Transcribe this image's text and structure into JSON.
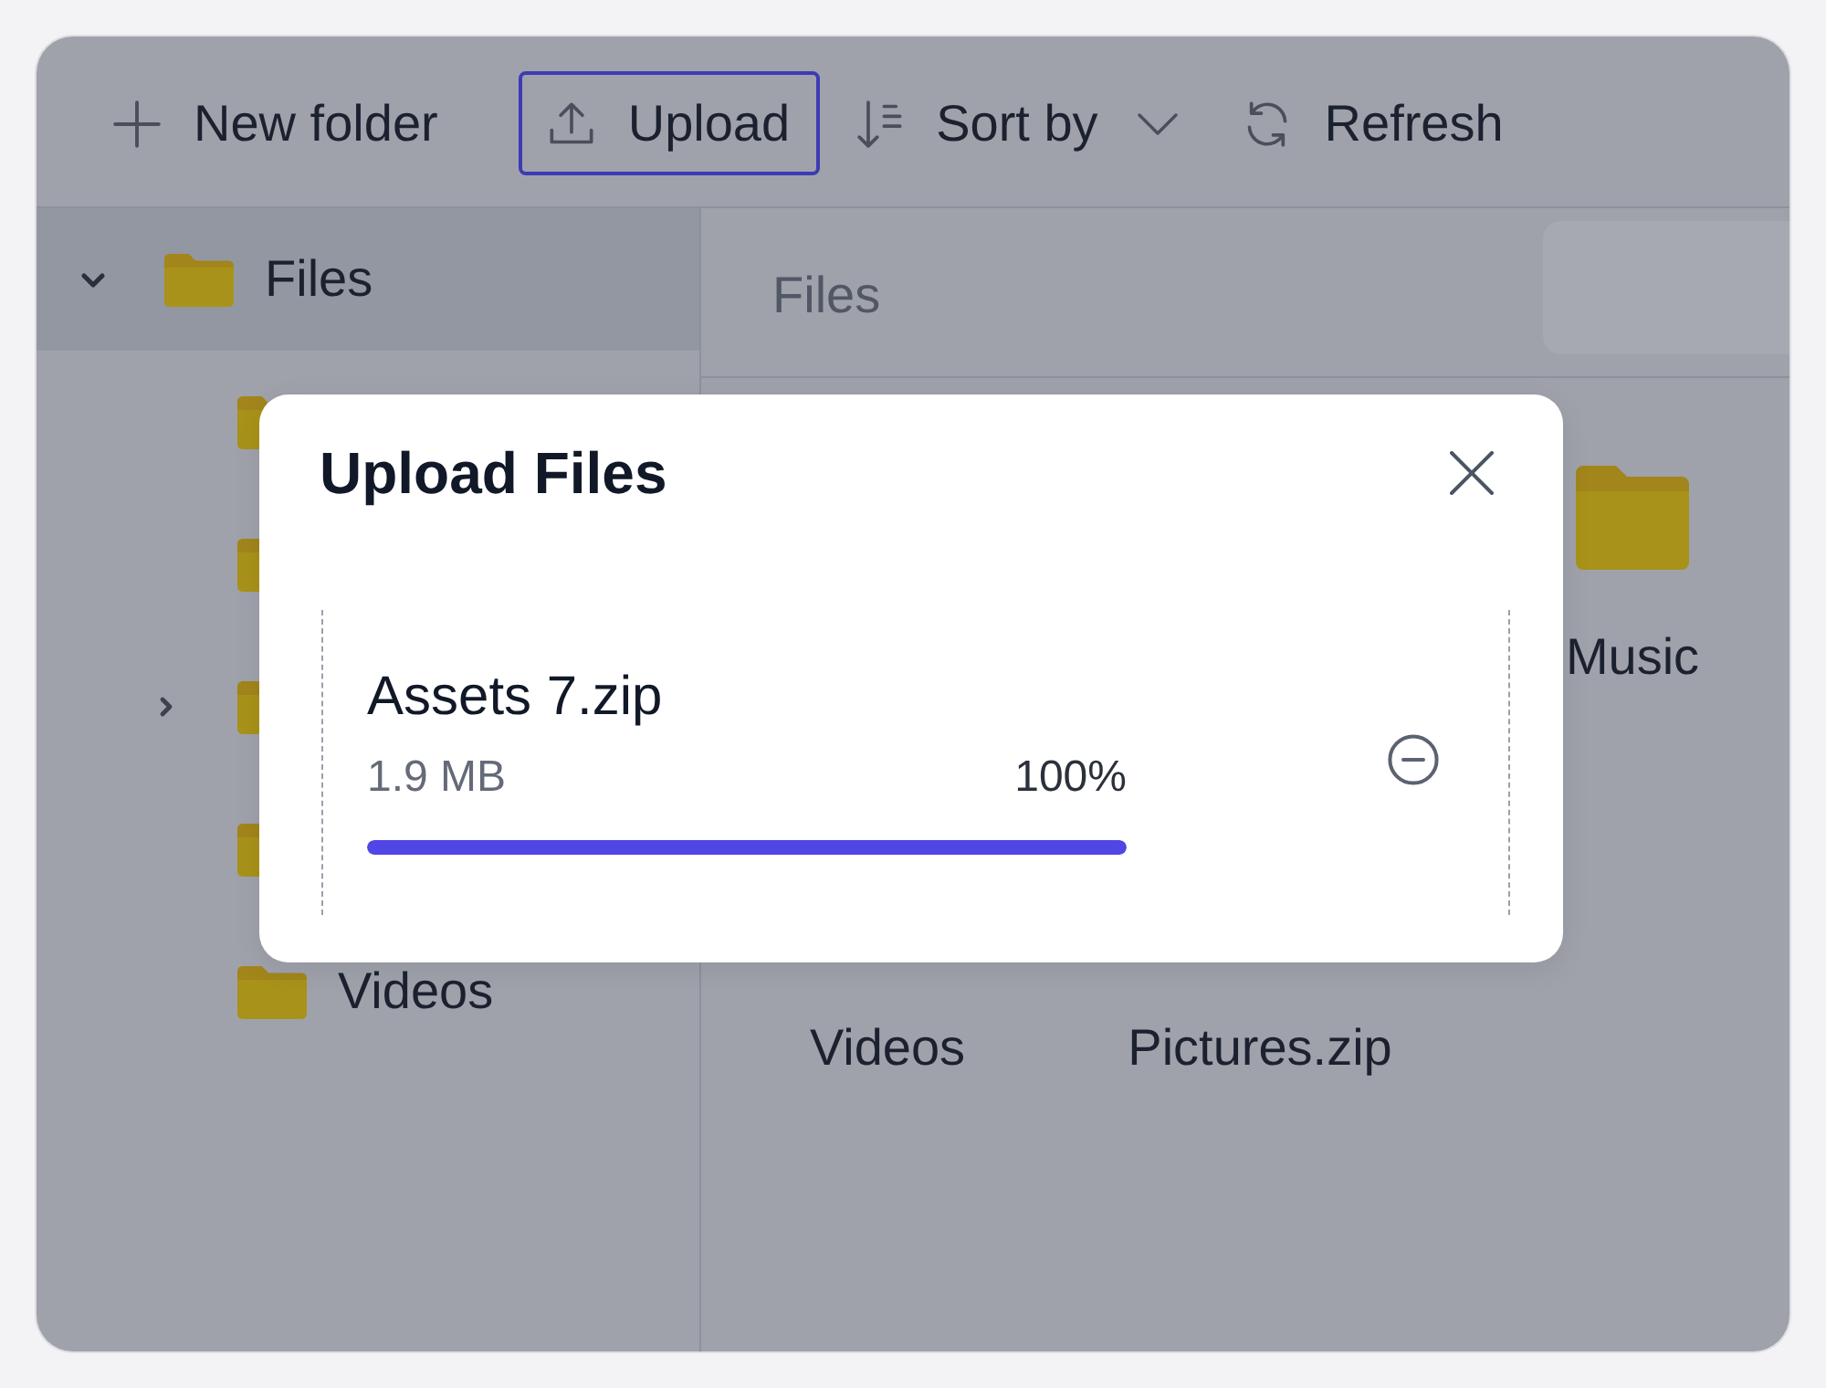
{
  "toolbar": {
    "buttons": [
      {
        "kind": "new_folder",
        "label": "New folder",
        "focused": false
      },
      {
        "kind": "upload",
        "label": "Upload",
        "focused": true
      },
      {
        "kind": "sort",
        "label": "Sort by",
        "focused": false
      },
      {
        "kind": "refresh",
        "label": "Refresh",
        "focused": false
      }
    ]
  },
  "sidebar": {
    "tree": [
      {
        "label": "Files",
        "selected": true,
        "expanded": true,
        "children": [
          {
            "selected": false
          },
          {
            "selected": false
          },
          {
            "selected": false,
            "expanded": false
          },
          {
            "selected": false
          },
          {
            "label": "Videos",
            "selected": false
          }
        ]
      }
    ]
  },
  "breadcrumb": {
    "path": [
      "Files"
    ]
  },
  "grid": {
    "items": [
      {
        "label": "Music",
        "kind": "folder"
      },
      {
        "label": "Videos"
      },
      {
        "label": "Pictures.zip"
      }
    ]
  },
  "dialog": {
    "title": "Upload Files",
    "uploads": [
      {
        "name": "Assets 7.zip",
        "size": "1.9 MB",
        "percent": "100%",
        "level": 1
      }
    ]
  }
}
